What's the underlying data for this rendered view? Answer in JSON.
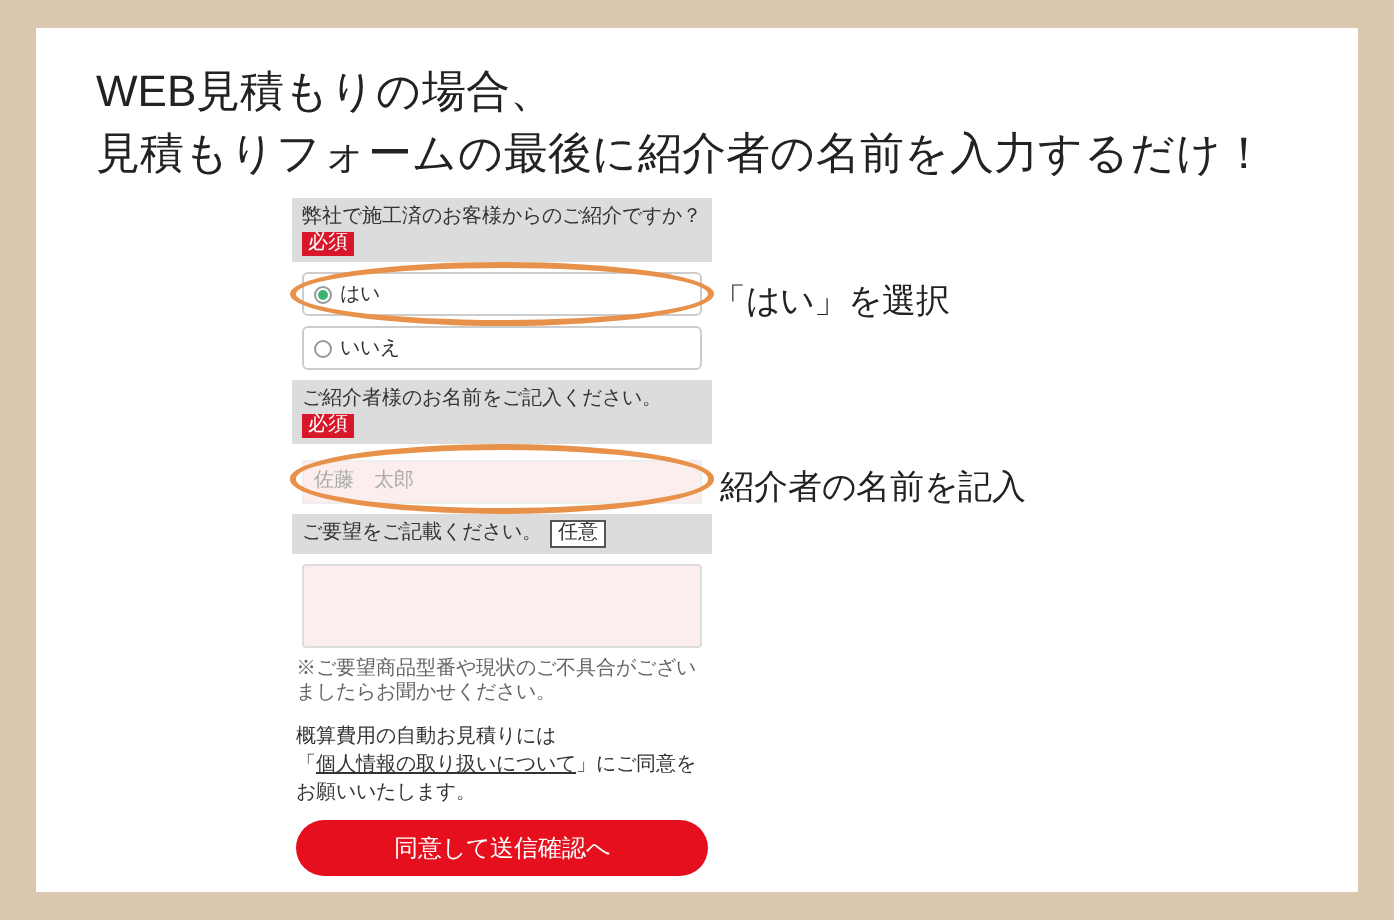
{
  "title_lines": [
    "WEB見積もりの場合、",
    "見積もりフォームの最後に紹介者の名前を入力するだけ！"
  ],
  "form": {
    "questions": [
      {
        "kind": "radio",
        "label": "弊社で施工済のお客様からのご紹介ですか？",
        "badge": {
          "text": "必須",
          "kind": "required"
        },
        "options": [
          {
            "label": "はい",
            "selected": true,
            "highlighted": true
          },
          {
            "label": "いいえ",
            "selected": false,
            "highlighted": false
          }
        ]
      },
      {
        "kind": "text",
        "label": "ご紹介者様のお名前をご記入ください。",
        "badge": {
          "text": "必須",
          "kind": "required"
        },
        "placeholder": "佐藤　太郎",
        "highlighted": true
      },
      {
        "kind": "textarea",
        "label": "ご要望をご記載ください。",
        "badge": {
          "text": "任意",
          "kind": "optional"
        },
        "note": "※ご要望商品型番や現状のご不具合がございましたらお聞かせください。"
      }
    ],
    "consent": {
      "before": "概算費用の自動お見積りには「",
      "link": "個人情報の取り扱いについて",
      "after": "」にご同意をお願いいたします。"
    },
    "submit": "同意して送信確認へ"
  },
  "annotations": [
    "「はい」を選択",
    "紹介者の名前を記入"
  ]
}
